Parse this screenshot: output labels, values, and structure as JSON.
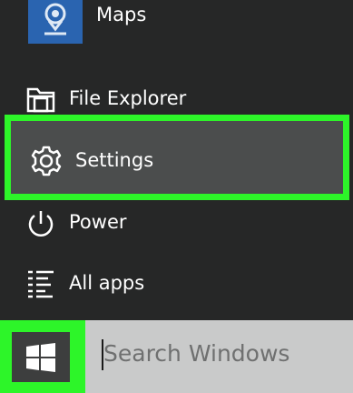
{
  "start_menu": {
    "pinned_app": {
      "label": "Maps",
      "icon": "map-pin-icon",
      "tile_color": "#2a64b0"
    },
    "items": [
      {
        "label": "File Explorer",
        "icon": "folder-icon"
      },
      {
        "label": "Settings",
        "icon": "gear-icon",
        "highlighted": true
      },
      {
        "label": "Power",
        "icon": "power-icon"
      },
      {
        "label": "All apps",
        "icon": "list-icon"
      }
    ]
  },
  "taskbar": {
    "start_icon": "windows-logo-icon",
    "search": {
      "placeholder": "Search Windows",
      "value": ""
    }
  },
  "colors": {
    "highlight": "#2df529",
    "menu_background": "#262727",
    "selected_background": "#4b4d4d",
    "search_background": "#c9caca"
  }
}
